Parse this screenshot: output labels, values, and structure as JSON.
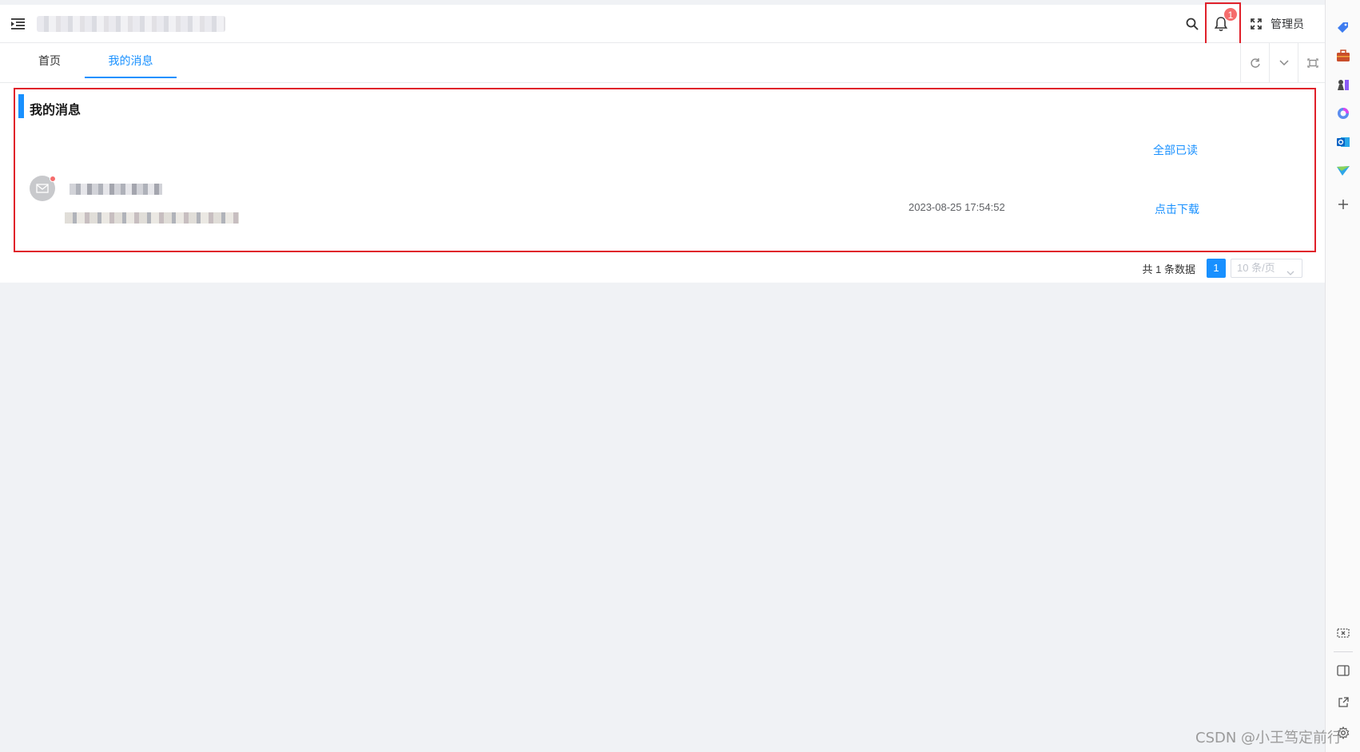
{
  "header": {
    "user_label": "管理员",
    "notification_count": "1"
  },
  "tabs": [
    {
      "label": "首页",
      "active": false
    },
    {
      "label": "我的消息",
      "active": true
    }
  ],
  "messages_panel": {
    "title": "我的消息",
    "mark_all_read": "全部已读",
    "items": [
      {
        "time": "2023-08-25 17:54:52",
        "action": "点击下载",
        "unread": true
      }
    ]
  },
  "pagination": {
    "total_text": "共 1 条数据",
    "current_page": "1",
    "page_size": "10 条/页"
  },
  "watermark": "CSDN @小王笃定前行",
  "colors": {
    "primary": "#1890ff",
    "badge": "#f56c6c",
    "highlight_border": "#e0202a",
    "page_bg": "#f0f2f5"
  },
  "sidebar_icons": [
    "tag-icon",
    "briefcase-icon",
    "chess-icon",
    "copilot-icon",
    "outlook-icon",
    "send-icon",
    "plus-icon",
    "screenshot-icon",
    "split-view-icon",
    "external-link-icon",
    "settings-icon"
  ]
}
